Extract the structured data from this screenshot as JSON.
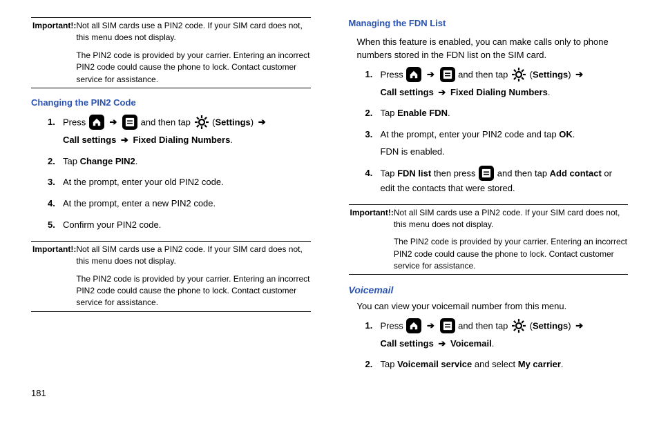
{
  "important1": {
    "label": "Important!:",
    "p1": "Not all SIM cards use a PIN2 code. If your SIM card does not, this menu does not display.",
    "p2": "The PIN2 code is provided by your carrier. Entering an incorrect PIN2 code could cause the phone to lock. Contact customer service for assistance."
  },
  "changing": {
    "heading": "Changing the PIN2 Code",
    "press": "Press ",
    "andthentap": " and then tap ",
    "settings_open": " (",
    "settings": "Settings",
    "settings_close": ")",
    "callsettings": "Call settings ",
    "fdn": " Fixed Dialing Numbers",
    "period": ".",
    "s2a": "Tap ",
    "s2b": "Change PIN2",
    "s3": "At the prompt, enter your old PIN2 code.",
    "s4": "At the prompt, enter a new PIN2 code.",
    "s5": "Confirm your PIN2 code."
  },
  "important2": {
    "label": "Important!:",
    "p1": "Not all SIM cards use a PIN2 code. If your SIM card does not, this menu does not display.",
    "p2": "The PIN2 code is provided by your carrier. Entering an incorrect PIN2 code could cause the phone to lock. Contact customer service for assistance."
  },
  "managing": {
    "heading": "Managing the FDN List",
    "intro": "When this feature is enabled, you can make calls only to phone numbers stored in the FDN list on the SIM card.",
    "press": "Press ",
    "andthentap": " and then tap ",
    "settings_open": " (",
    "settings": "Settings",
    "settings_close": ")",
    "callsettings": "Call settings ",
    "fdn": " Fixed Dialing Numbers",
    "period": ".",
    "s2a": "Tap ",
    "s2b": "Enable FDN",
    "s3a": "At the prompt, enter your PIN2 code and tap ",
    "s3b": "OK",
    "s3c": "FDN is enabled.",
    "s4a": "Tap ",
    "s4b": "FDN list",
    "s4c": " then press ",
    "s4d": " and then tap ",
    "s4e": "Add contact",
    "s4f": " or edit the contacts that were stored."
  },
  "important3": {
    "label": "Important!:",
    "p1": "Not all SIM cards use a PIN2 code. If your SIM card does not, this menu does not display.",
    "p2": "The PIN2 code is provided by your carrier. Entering an incorrect PIN2 code could cause the phone to lock. Contact customer service for assistance."
  },
  "voicemail": {
    "heading": "Voicemail",
    "intro": "You can view your voicemail number from this menu.",
    "press": "Press ",
    "andthentap": " and then tap ",
    "settings_open": " (",
    "settings": "Settings",
    "settings_close": ")",
    "callsettings": "Call settings ",
    "vm": " Voicemail",
    "period": ".",
    "s2a": "Tap ",
    "s2b": "Voicemail service",
    "s2c": " and select ",
    "s2d": "My carrier",
    "s2e": "."
  },
  "arrow": "➔",
  "pagenum": "181"
}
